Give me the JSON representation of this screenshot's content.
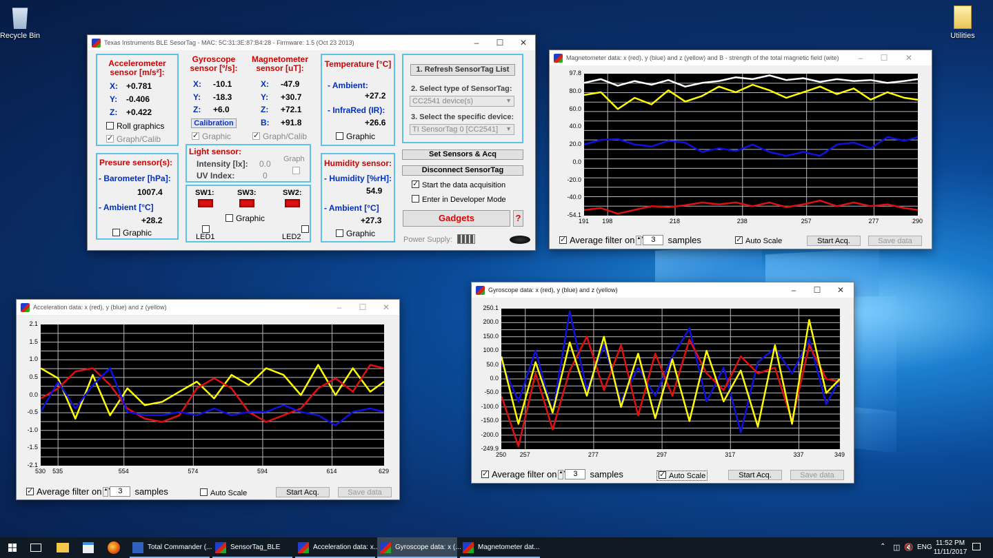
{
  "desktop": {
    "icons": [
      {
        "label": "Recycle Bin",
        "icon": "recycle-bin-icon"
      },
      {
        "label": "Utilities",
        "icon": "folder-icon"
      }
    ]
  },
  "main": {
    "title": "Texas Instruments BLE SesorTag  -  MAC: 5C:31:3E:87:B4:28  -  Firmware: 1.5 (Oct 23 2013)",
    "accel": {
      "title1": "Accelerometer",
      "title2": "sensor [m/s²]:",
      "x_label": "X:",
      "x": "+0.781",
      "y_label": "Y:",
      "y": "-0.406",
      "z_label": "Z:",
      "z": "+0.422",
      "roll": "Roll graphics",
      "graph": "Graph/Calib"
    },
    "gyro": {
      "title1": "Gyroscope",
      "title2": "sensor [º/s]:",
      "x_label": "X:",
      "x": "-10.1",
      "y_label": "Y:",
      "y": "-18.3",
      "z_label": "Z:",
      "z": "+6.0",
      "calibration": "Calibration",
      "graphic": "Graphic"
    },
    "mag": {
      "title1": "Magnetometer",
      "title2": "sensor [uT]:",
      "x_label": "X:",
      "x": "-47.9",
      "y_label": "Y:",
      "y": "+30.7",
      "z_label": "Z:",
      "z": "+72.1",
      "b_label": "B:",
      "b": "+91.8",
      "graph": "Graph/Calib"
    },
    "temp": {
      "title": "Temperature [°C]",
      "ambient_label": "- Ambient:",
      "ambient": "+27.2",
      "ir_label": "- InfraRed (IR):",
      "ir": "+26.6",
      "graphic": "Graphic"
    },
    "pressure": {
      "title": "Presure sensor(s):",
      "baro_label": "- Barometer  [hPa]:",
      "baro": "1007.4",
      "ambient_label": "- Ambient  [°C]",
      "ambient": "+28.2",
      "graphic": "Graphic"
    },
    "light": {
      "title": "Light sensor:",
      "intensity_label": "Intensity [lx]:",
      "intensity": "0.0",
      "uv_label": "UV Index:",
      "uv": "0",
      "graph": "Graph"
    },
    "switches": {
      "sw1": "SW1:",
      "sw3": "SW3:",
      "sw2": "SW2:",
      "graphic": "Graphic",
      "led1": "LED1",
      "led2": "LED2"
    },
    "humidity": {
      "title": "Humidity sensor:",
      "hum_label": "- Humidity [%rH]:",
      "hum": "54.9",
      "ambient_label": "- Ambient  [°C]",
      "ambient": "+27.3",
      "graphic": "Graphic"
    },
    "control": {
      "refresh": "1. Refresh SensorTag List",
      "select_type": "2. Select type of SensorTag:",
      "type_value": "CC2541 device(s)",
      "select_device": "3. Select the specific device:",
      "device_value": "TI SensorTag 0 [CC2541]",
      "set_sensors": "Set Sensors & Acq",
      "disconnect": "Disconnect SensorTag",
      "start_acq": "Start the data acquisition",
      "dev_mode": "Enter in Developer Mode",
      "gadgets": "Gadgets",
      "help": "?",
      "power": "Power Supply:"
    }
  },
  "mag_window": {
    "title": "Magnetometer data: x (red), y (blue) and z (yellow) and B - strength of the total magnetic field (wite)",
    "avg": "Average filter on",
    "samples_value": "3",
    "samples": "samples",
    "auto": "Auto Scale",
    "start": "Start Acq.",
    "save": "Save data",
    "yticks": [
      "97.8",
      "80.0",
      "60.0",
      "40.0",
      "20.0",
      "0.0",
      "-20.0",
      "-40.0",
      "-54.1"
    ],
    "xticks": [
      "191",
      "198",
      "218",
      "238",
      "257",
      "277",
      "290"
    ]
  },
  "acc_window": {
    "title": "Acceleration data: x (red), y (blue) and z (yellow)",
    "avg": "Average filter on",
    "samples_value": "3",
    "samples": "samples",
    "auto": "Auto Scale",
    "start": "Start Acq.",
    "save": "Save data",
    "yticks": [
      "2.1",
      "1.5",
      "1.0",
      "0.5",
      "0.0",
      "-0.5",
      "-1.0",
      "-1.5",
      "-2.1"
    ],
    "xticks": [
      "530",
      "535",
      "554",
      "574",
      "594",
      "614",
      "629"
    ]
  },
  "gyro_window": {
    "title": "Gyroscope data: x (red), y (blue) and z (yellow)",
    "avg": "Average filter on",
    "samples_value": "3",
    "samples": "samples",
    "auto": "Auto Scale",
    "start": "Start Acq.",
    "save": "Save data",
    "yticks": [
      "250.1",
      "200.0",
      "150.0",
      "100.0",
      "50.0",
      "0.0",
      "-50.0",
      "-100.0",
      "-150.0",
      "-200.0",
      "-249.9"
    ],
    "xticks": [
      "250",
      "257",
      "277",
      "297",
      "317",
      "337",
      "349"
    ]
  },
  "chart_data": [
    {
      "type": "line",
      "title": "Magnetometer data: x (red), y (blue) and z (yellow) and B - strength of the total magnetic field (wite)",
      "ylim": [
        -54.1,
        97.8
      ],
      "xlim": [
        191,
        290
      ],
      "x": [
        191,
        196,
        201,
        206,
        211,
        216,
        221,
        226,
        231,
        236,
        241,
        246,
        251,
        256,
        261,
        266,
        271,
        276,
        281,
        286,
        290
      ],
      "series": [
        {
          "color": "#ffffff",
          "values": [
            88,
            92,
            85,
            90,
            86,
            91,
            84,
            88,
            90,
            94,
            92,
            96,
            91,
            93,
            89,
            92,
            90,
            91,
            88,
            90,
            92
          ]
        },
        {
          "color": "#ffff00",
          "values": [
            75,
            78,
            60,
            72,
            65,
            80,
            68,
            74,
            84,
            78,
            86,
            80,
            72,
            78,
            84,
            76,
            82,
            70,
            78,
            72,
            70
          ]
        },
        {
          "color": "#1010e0",
          "values": [
            22,
            27,
            28,
            22,
            20,
            26,
            24,
            14,
            18,
            15,
            22,
            14,
            10,
            14,
            10,
            22,
            24,
            18,
            30,
            26,
            30
          ]
        },
        {
          "color": "#e01010",
          "values": [
            -48,
            -46,
            -52,
            -48,
            -44,
            -45,
            -43,
            -40,
            -42,
            -40,
            -44,
            -40,
            -45,
            -42,
            -38,
            -44,
            -40,
            -44,
            -42,
            -46,
            -48
          ]
        }
      ]
    },
    {
      "type": "line",
      "title": "Acceleration data: x (red), y (blue) and z (yellow)",
      "ylim": [
        -2.1,
        2.1
      ],
      "xlim": [
        530,
        629
      ],
      "x": [
        530,
        535,
        540,
        545,
        550,
        555,
        560,
        565,
        570,
        575,
        580,
        585,
        590,
        595,
        600,
        605,
        610,
        615,
        620,
        625,
        629
      ],
      "series": [
        {
          "color": "#ffff00",
          "values": [
            0.8,
            0.5,
            -0.7,
            0.6,
            -0.6,
            0.2,
            -0.3,
            -0.2,
            0.1,
            0.4,
            -0.1,
            0.6,
            0.3,
            0.8,
            0.6,
            0.0,
            0.9,
            0.0,
            0.8,
            0.1,
            0.4
          ]
        },
        {
          "color": "#e01010",
          "values": [
            -0.1,
            0.2,
            0.7,
            0.8,
            0.3,
            -0.4,
            -0.7,
            -0.8,
            -0.6,
            0.2,
            0.5,
            0.2,
            -0.5,
            -0.8,
            -0.6,
            -0.4,
            0.2,
            0.5,
            0.1,
            0.9,
            0.8
          ]
        },
        {
          "color": "#1010e0",
          "values": [
            -0.5,
            0.4,
            -0.4,
            0.3,
            0.8,
            -0.5,
            -0.6,
            -0.6,
            -0.5,
            -0.6,
            -0.4,
            -0.6,
            -0.5,
            -0.5,
            -0.3,
            -0.5,
            -0.6,
            -0.9,
            -0.5,
            -0.4,
            -0.5
          ]
        }
      ]
    },
    {
      "type": "line",
      "title": "Gyroscope data: x (red), y (blue) and z (yellow)",
      "ylim": [
        -249.9,
        250.1
      ],
      "xlim": [
        250,
        349
      ],
      "x": [
        250,
        255,
        260,
        265,
        270,
        275,
        280,
        285,
        290,
        295,
        300,
        305,
        310,
        315,
        320,
        325,
        330,
        335,
        340,
        345,
        349
      ],
      "series": [
        {
          "color": "#1010e0",
          "values": [
            60,
            -80,
            100,
            -120,
            240,
            -40,
            120,
            -80,
            40,
            -60,
            80,
            180,
            -80,
            40,
            -190,
            60,
            110,
            20,
            140,
            -90,
            0
          ]
        },
        {
          "color": "#e01010",
          "values": [
            -60,
            -240,
            20,
            -180,
            30,
            150,
            -40,
            120,
            -130,
            90,
            -60,
            140,
            20,
            -40,
            80,
            20,
            40,
            -150,
            120,
            0,
            -10
          ]
        },
        {
          "color": "#ffff00",
          "values": [
            80,
            -160,
            60,
            -120,
            130,
            -60,
            150,
            -100,
            90,
            -140,
            70,
            -150,
            100,
            -80,
            30,
            -170,
            120,
            -160,
            210,
            -50,
            0
          ]
        }
      ]
    }
  ],
  "taskbar": {
    "items": [
      "Total Commander (...",
      "SensorTag_BLE",
      "Acceleration data: x...",
      "Gyroscope data: x (...",
      "Magnetometer dat..."
    ],
    "lang": "ENG",
    "time": "11:52 PM",
    "date": "11/11/2017"
  }
}
